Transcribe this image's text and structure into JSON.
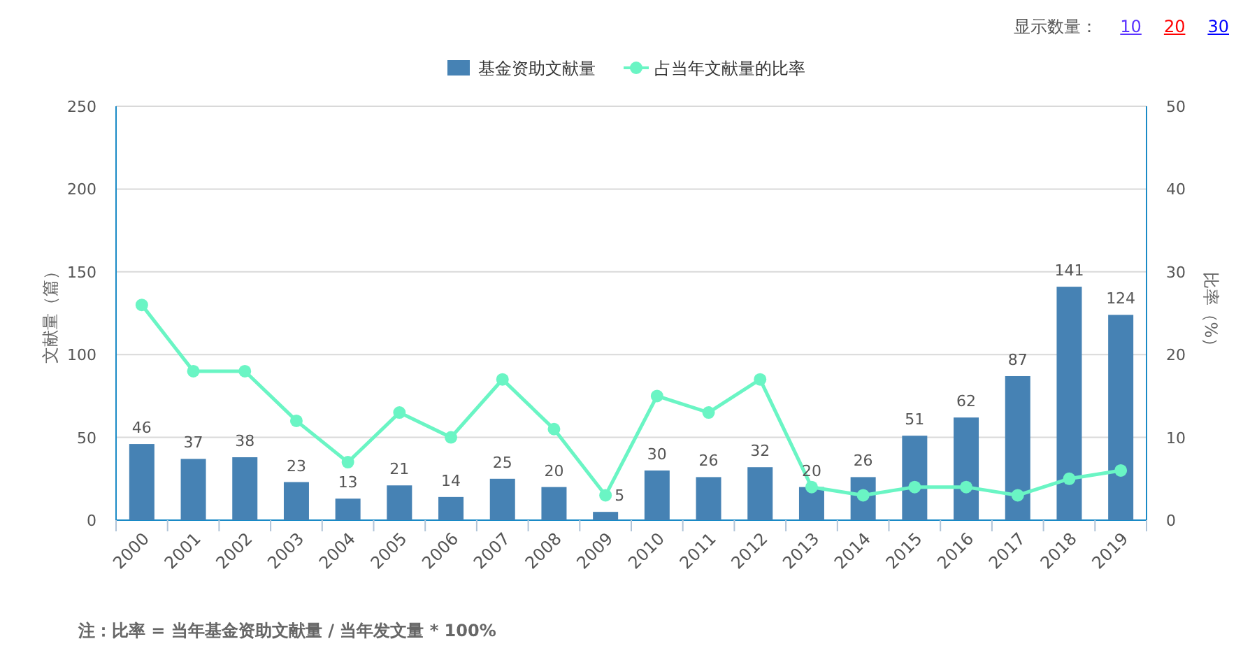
{
  "display_count": {
    "label": "显示数量：",
    "options": [
      {
        "label": "10",
        "color": "#5b33ff"
      },
      {
        "label": "20",
        "color": "#ff0000"
      },
      {
        "label": "30",
        "color": "#0000ff"
      }
    ]
  },
  "chart": {
    "chart_data": {
      "type": "bar",
      "categories": [
        "2000",
        "2001",
        "2002",
        "2003",
        "2004",
        "2005",
        "2006",
        "2007",
        "2008",
        "2009",
        "2010",
        "2011",
        "2012",
        "2013",
        "2014",
        "2015",
        "2016",
        "2017",
        "2018",
        "2019"
      ],
      "series": [
        {
          "name": "基金资助文献量",
          "color": "#4682b4",
          "data_labels": true,
          "values": [
            46,
            37,
            38,
            23,
            13,
            21,
            14,
            25,
            20,
            5,
            30,
            26,
            32,
            20,
            26,
            51,
            62,
            87,
            141,
            124
          ]
        },
        {
          "name": "占当年文献量的比率",
          "type": "line",
          "axis": "y2",
          "marker": "circle",
          "color": "#6af5c4",
          "values": [
            26,
            18,
            18,
            12,
            7,
            13,
            10,
            17,
            11,
            3,
            15,
            13,
            17,
            4,
            3,
            4,
            4,
            3,
            5,
            6
          ]
        }
      ],
      "grid": true,
      "legend": true,
      "ylabel": "文献量（篇）",
      "ylim": [
        0,
        250
      ],
      "yticks": [
        0,
        50,
        100,
        150,
        200,
        250
      ],
      "y2label": "比率（%）",
      "y2lim": [
        0,
        50
      ],
      "y2ticks": [
        0,
        10,
        20,
        30,
        40,
        50
      ]
    }
  },
  "note": "注：比率 = 当年基金资助文献量 / 当年发文量 * 100%"
}
